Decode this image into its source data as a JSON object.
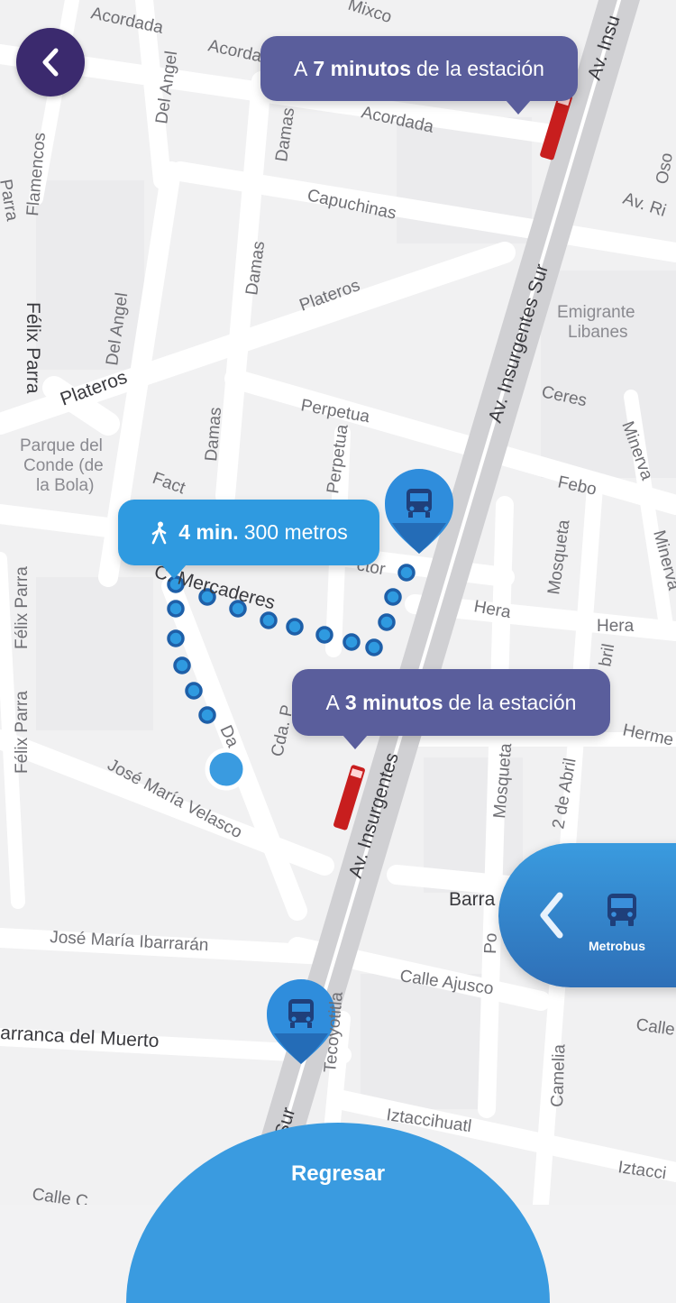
{
  "bubbles": {
    "top": {
      "prefix": "A",
      "bold": "7 minutos",
      "suffix": "de la estación"
    },
    "bottom": {
      "prefix": "A",
      "bold": "3 minutos",
      "suffix": "de la estación"
    },
    "walk": {
      "bold": "4 min.",
      "suffix": "300 metros"
    }
  },
  "side_panel": {
    "label": "Metrobus"
  },
  "footer": {
    "button_label": "Regresar"
  },
  "streets": {
    "acordada_1": "Acordada",
    "acordada_2": "Acorda",
    "acordada_3": "Acordada",
    "mixcoac": "Mixco",
    "av_insurgentes_top": "Av. Insu",
    "del_angel_1": "Del Angel",
    "del_angel_2": "Del Angel",
    "flamencos": "Flamencos",
    "parra": "Parra",
    "damas_1": "Damas",
    "damas_2": "Damas",
    "damas_3": "Damas",
    "damas_4": "Da",
    "capuchinas": "Capuchinas",
    "av_rio": "Av. Ri",
    "oso": "Oso",
    "plateros_1": "Plateros",
    "plateros_2": "Plateros",
    "felix_parra_1": "Félix Parra",
    "felix_parra_2": "Félix Parra",
    "felix_parra_3": "Félix Parra",
    "emigrante_1": "Emigrante",
    "emigrante_2": "Libanes",
    "av_insurgentes_sur": "Av. Insurgentes Sur",
    "ceres": "Ceres",
    "perpetua_1": "Perpetua",
    "perpetua_2": "Perpetua",
    "minerva_1": "Minerva",
    "minerva_2": "Minerva",
    "parque_1": "Parque del",
    "parque_2": "Conde (de",
    "parque_3": "la Bola)",
    "factor": "Fact",
    "ctor": "ctor",
    "febo": "Febo",
    "mosqueta_1": "Mosqueta",
    "mosqueta_2": "Mosqueta",
    "hera_1": "Hera",
    "hera_2": "Hera",
    "mercaderes": "C. Mercaderes",
    "abril_1": "bril",
    "abril_2": "2 de Abril",
    "hermes": "Herme",
    "cda_p": "Cda. P",
    "jose_maria_velasco": "José María Velasco",
    "av_insurgentes_bottom": "Av. Insurgentes",
    "barranca": "Barra",
    "po": "Po",
    "jose_maria_ibarraran": "José María Ibarrarán",
    "calle_ajusco": "Calle Ajusco",
    "arranca_del_muerto": "arranca del Muerto",
    "tecoyotitla": "Tecoyotitla",
    "calle_r": "Calle",
    "camelia": "Camelia",
    "sur": "Sur",
    "iztaccihuatl_1": "Iztaccihuatl",
    "iztaccihuatl_2": "Iztacci",
    "calle_bottom": "Calle C"
  }
}
